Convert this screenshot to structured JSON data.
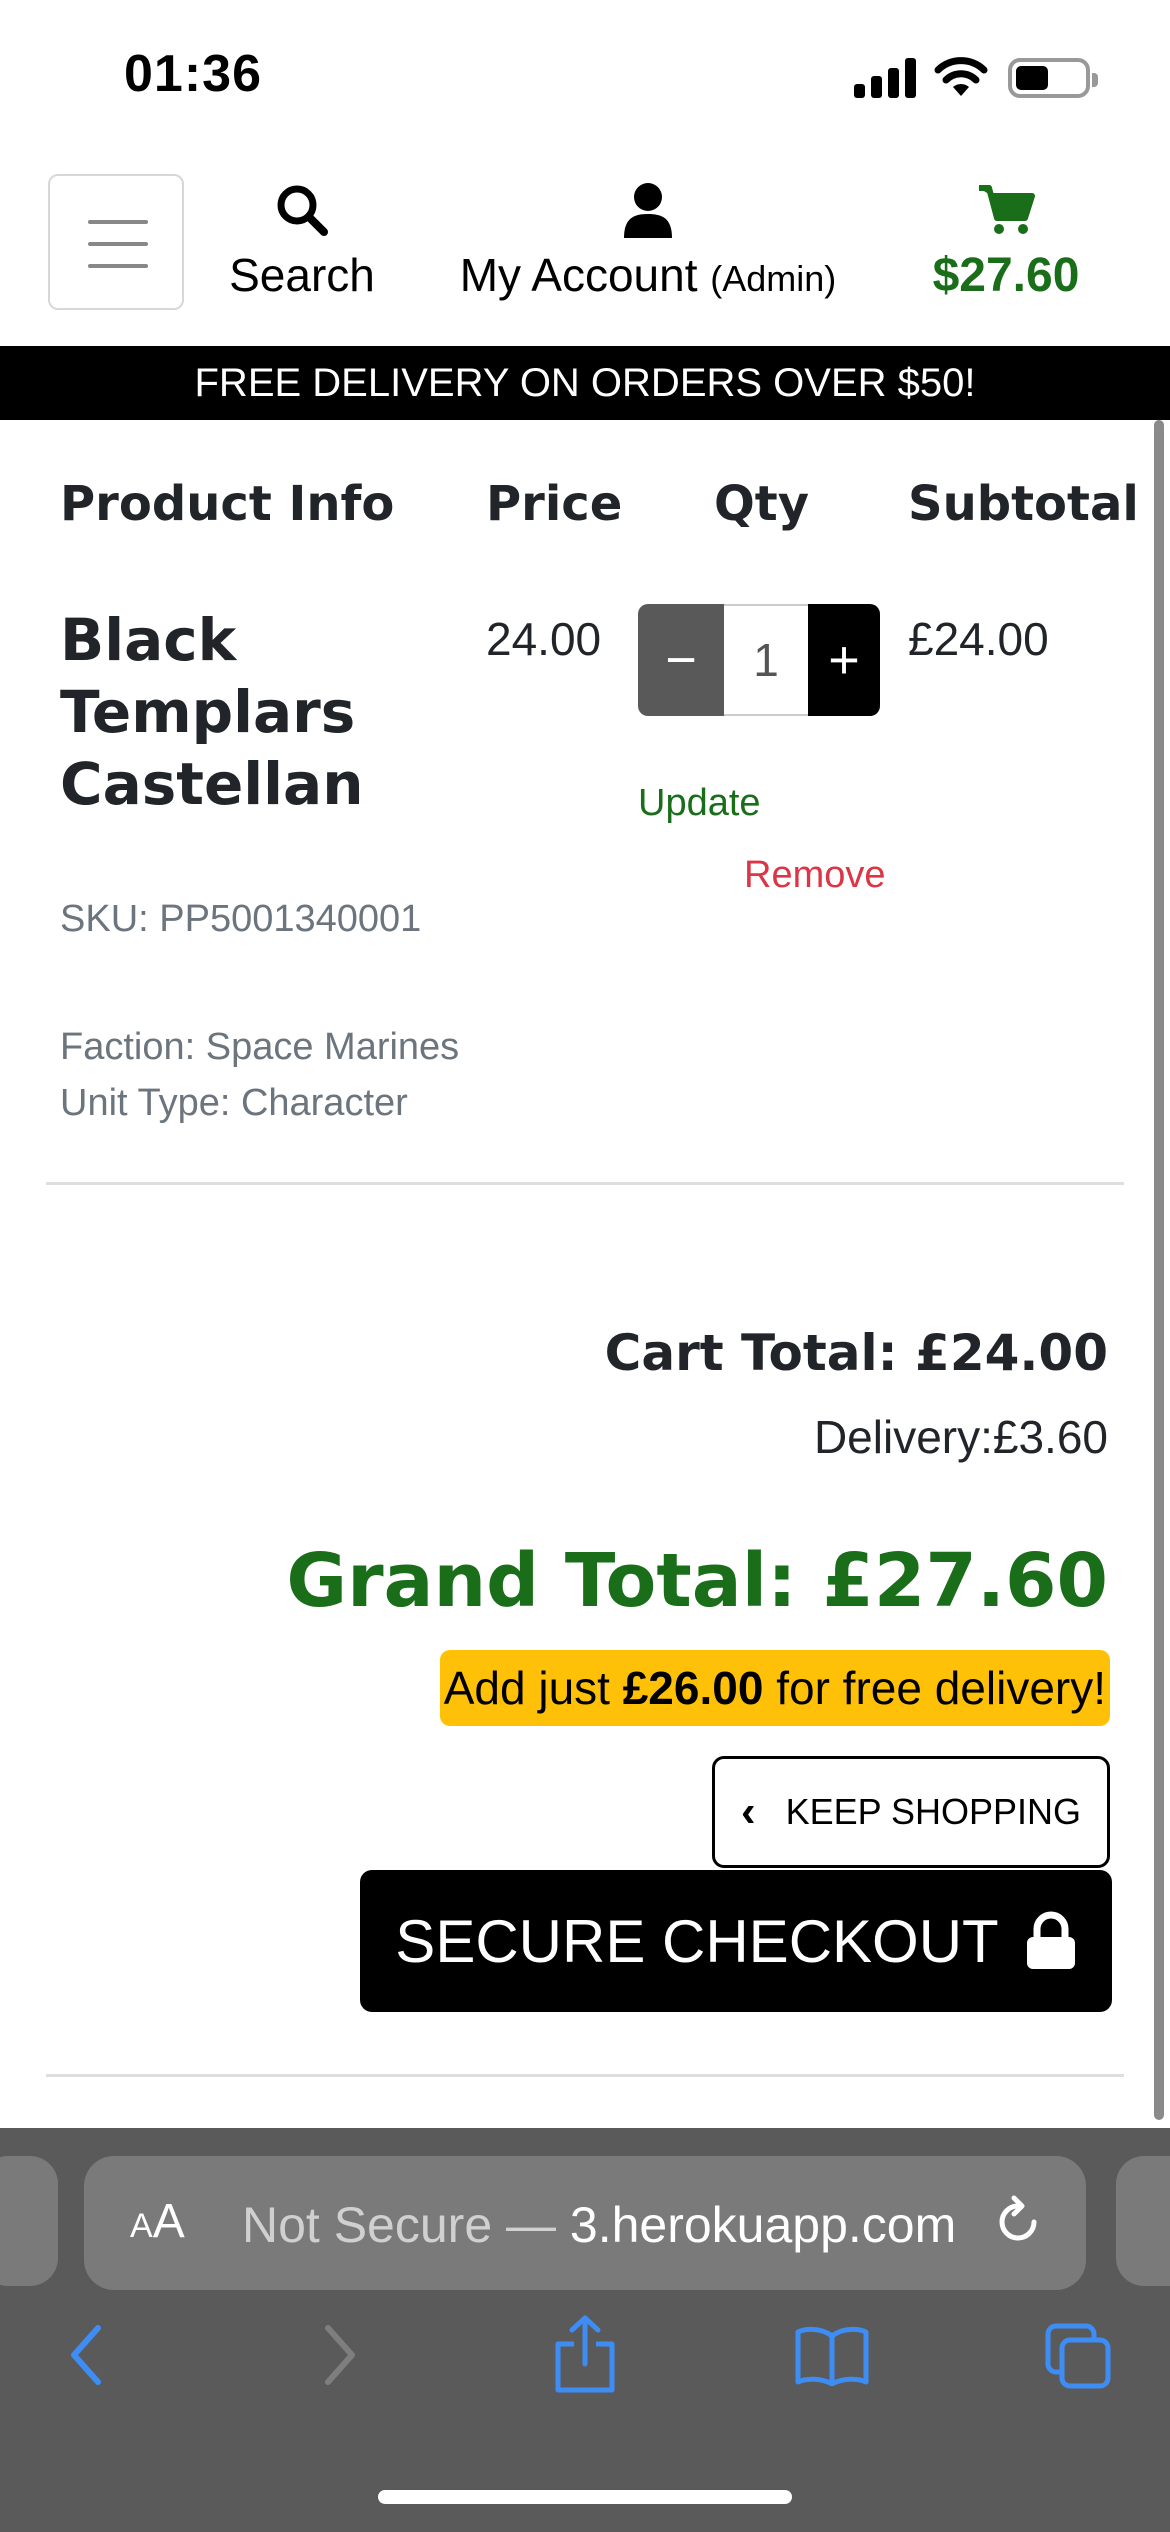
{
  "status_bar": {
    "time": "01:36"
  },
  "header": {
    "search_label": "Search",
    "account_label": "My Account",
    "account_role": "(Admin)",
    "cart_total": "$27.60"
  },
  "banner": {
    "text": "FREE DELIVERY ON ORDERS OVER $50!"
  },
  "table": {
    "headers": [
      "Product Info",
      "Price",
      "Qty",
      "Subtotal"
    ],
    "item": {
      "name_lines": [
        "Black",
        "Templars",
        "Castellan"
      ],
      "price": "24.00",
      "qty": "1",
      "subtotal": "£24.00",
      "update_label": "Update",
      "remove_label": "Remove",
      "sku": "SKU: PP5001340001",
      "faction": "Faction: Space Marines",
      "unit_type": "Unit Type: Character"
    }
  },
  "totals": {
    "cart_total": "Cart Total: £24.00",
    "delivery": "Delivery:£3.60",
    "grand_total": "Grand Total: £27.60",
    "free_prefix": "Add just",
    "free_amount": "£26.00",
    "free_suffix": "for free delivery!"
  },
  "buttons": {
    "keep_shopping": "KEEP SHOPPING",
    "secure_checkout": "SECURE CHECKOUT"
  },
  "browser": {
    "aa_small": "A",
    "aa_large": "A",
    "url_prefix": "Not Secure — ",
    "url_host": "3.herokuapp.com"
  },
  "colors": {
    "accent_green": "#1a6e1a",
    "remove_red": "#dc3545",
    "badge_yellow": "#ffc107",
    "ios_blue": "#3d8df5"
  }
}
